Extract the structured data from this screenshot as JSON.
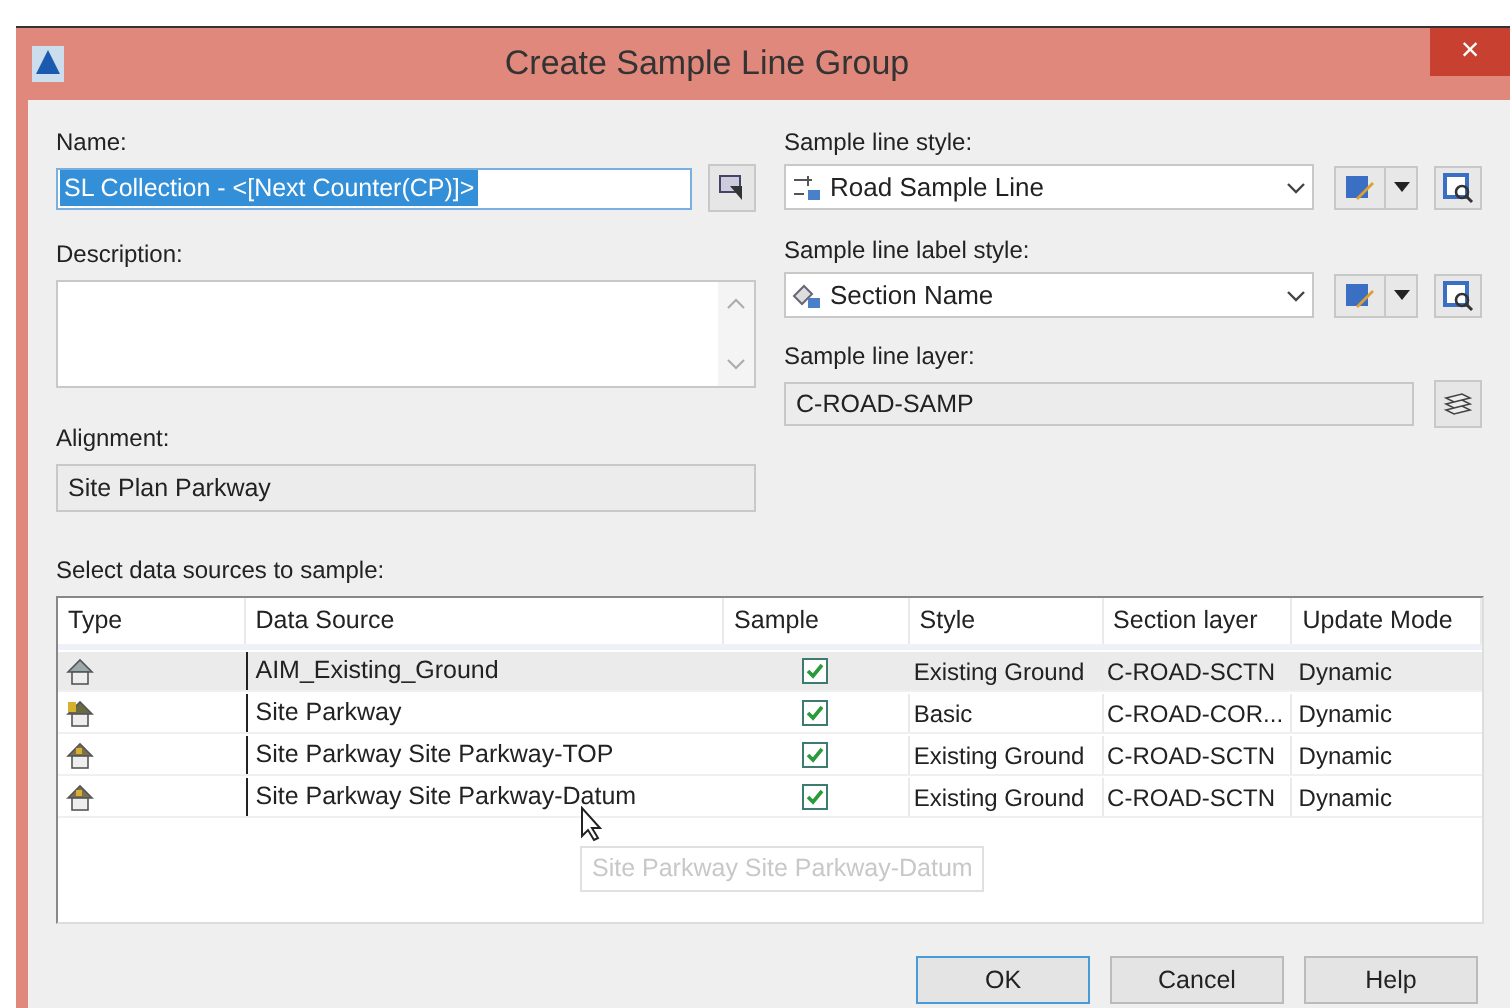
{
  "window": {
    "title": "Create Sample Line Group",
    "close": "×"
  },
  "name": {
    "label": "Name:",
    "value": "SL Collection - <[Next Counter(CP)]>"
  },
  "description": {
    "label": "Description:"
  },
  "alignment": {
    "label": "Alignment:",
    "value": "Site Plan Parkway"
  },
  "sample_line_style": {
    "label": "Sample line style:",
    "value": "Road Sample Line"
  },
  "sample_line_label_style": {
    "label": "Sample line label style:",
    "value": "Section Name"
  },
  "sample_line_layer": {
    "label": "Sample line layer:",
    "value": "C-ROAD-SAMP"
  },
  "table": {
    "label": "Select data sources to sample:",
    "columns": [
      "Type",
      "Data Source",
      "Sample",
      "Style",
      "Section layer",
      "Update Mode"
    ],
    "rows": [
      {
        "kind": "surface",
        "data_source": "AIM_Existing_Ground",
        "sample": true,
        "style": "Existing Ground",
        "section_layer": "C-ROAD-SCTN",
        "update_mode": "Dynamic",
        "selected": true
      },
      {
        "kind": "corridor",
        "data_source": "Site Parkway",
        "sample": true,
        "style": "Basic",
        "section_layer": "C-ROAD-COR...",
        "update_mode": "Dynamic",
        "selected": false
      },
      {
        "kind": "corridor_surface",
        "data_source": "Site Parkway Site Parkway-TOP",
        "sample": true,
        "style": "Existing Ground",
        "section_layer": "C-ROAD-SCTN",
        "update_mode": "Dynamic",
        "selected": false
      },
      {
        "kind": "corridor_surface",
        "data_source": "Site Parkway Site Parkway-Datum",
        "sample": true,
        "style": "Existing Ground",
        "section_layer": "C-ROAD-SCTN",
        "update_mode": "Dynamic",
        "selected": false
      }
    ],
    "tooltip": "Site Parkway Site Parkway-Datum"
  },
  "buttons": [
    {
      "label": "OK",
      "default": true
    },
    {
      "label": "Cancel",
      "default": false
    },
    {
      "label": "Help",
      "default": false
    }
  ]
}
